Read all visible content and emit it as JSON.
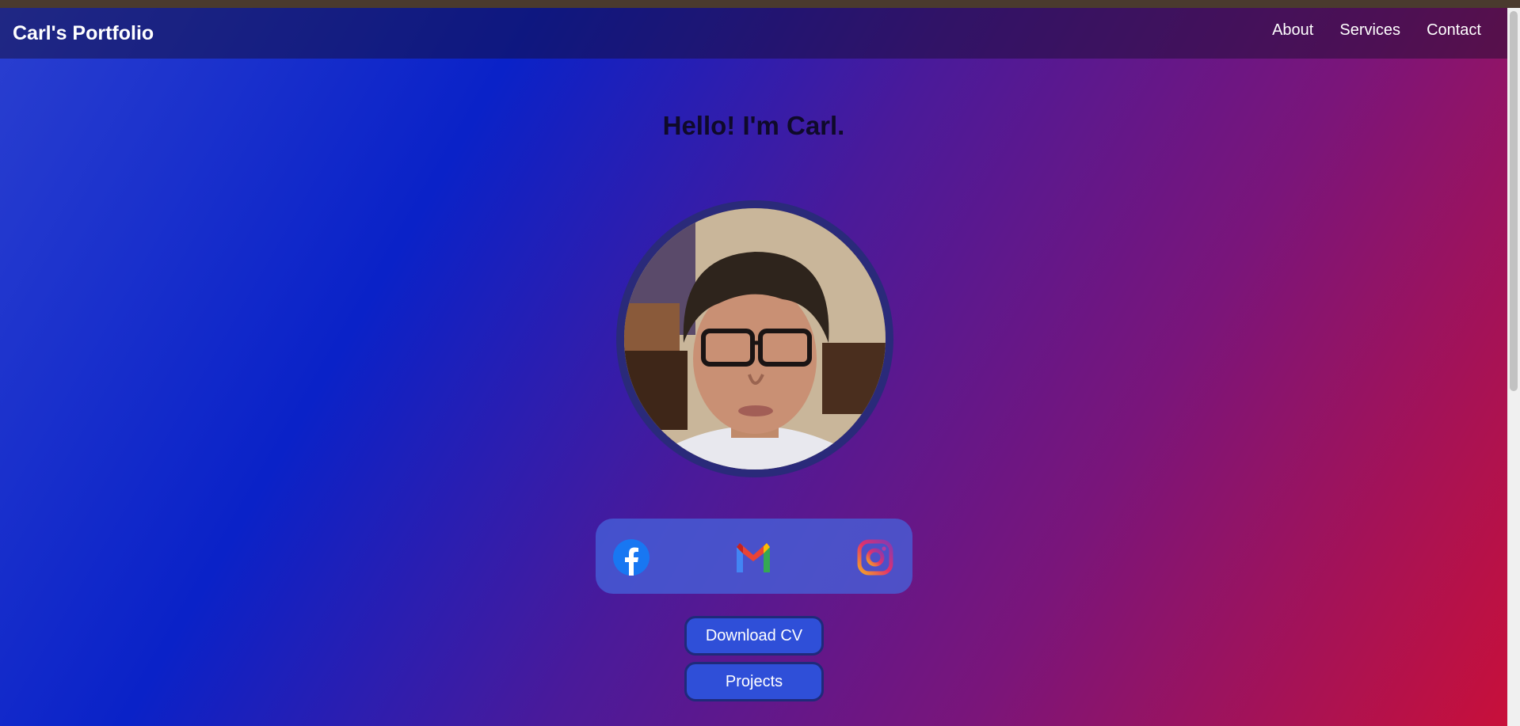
{
  "header": {
    "brand": "Carl's Portfolio",
    "nav": [
      {
        "label": "About"
      },
      {
        "label": "Services"
      },
      {
        "label": "Contact"
      }
    ]
  },
  "hero": {
    "headline": "Hello! I'm Carl."
  },
  "social": {
    "icons": [
      "facebook-icon",
      "gmail-icon",
      "instagram-icon"
    ]
  },
  "buttons": {
    "download_cv": "Download CV",
    "projects": "Projects"
  },
  "colors": {
    "button_bg": "#2f4fd8",
    "headline": "#0f0a2a"
  }
}
